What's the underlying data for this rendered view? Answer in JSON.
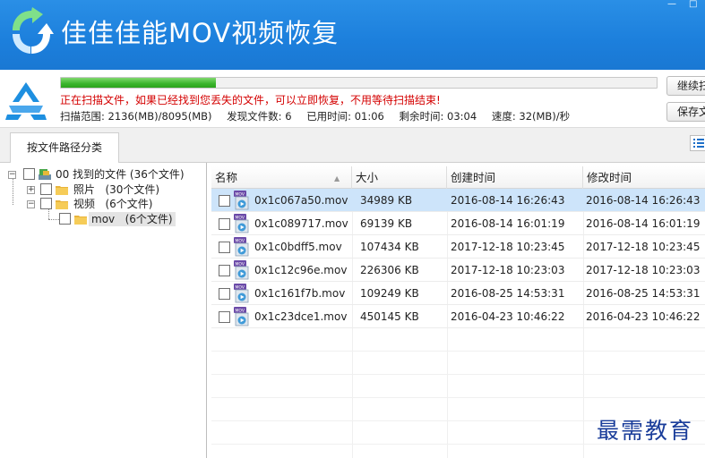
{
  "app": {
    "title": "佳佳佳能MOV视频恢复",
    "logo_icon": "recycle-arrows-logo",
    "colors": {
      "titlebar": "#1c7fdc",
      "status_red": "#d40000",
      "progress_green": "#3bb42c",
      "selection": "#cde4fa"
    }
  },
  "scan": {
    "progress": 0.26,
    "status": "正在扫描文件，如果已经找到您丢失的文件，可以立即恢复，不用等待扫描结束!",
    "range": "扫描范围: 2136(MB)/8095(MB)",
    "found": "发现文件数: 6",
    "elapsed": "已用时间: 01:06",
    "remaining": "剩余时间: 03:04",
    "speed": "速度: 32(MB)/秒",
    "buttons": {
      "continue": "继续扫",
      "save": "保存文"
    }
  },
  "tabs": {
    "by_path": "按文件路径分类"
  },
  "tree": {
    "root": {
      "label": "00 找到的文件",
      "count": "(36个文件)"
    },
    "photos": {
      "label": "照片",
      "count": "(30个文件)"
    },
    "videos": {
      "label": "视频",
      "count": "(6个文件)"
    },
    "mov": {
      "label": "mov",
      "count": "(6个文件)"
    }
  },
  "list": {
    "columns": {
      "name": "名称",
      "size": "大小",
      "created": "创建时间",
      "modified": "修改时间"
    },
    "rows": [
      {
        "name": "0x1c067a50.mov",
        "size": "34989 KB",
        "created": "2016-08-14  16:26:43",
        "modified": "2016-08-14  16:26:43"
      },
      {
        "name": "0x1c089717.mov",
        "size": "69139 KB",
        "created": "2016-08-14  16:01:19",
        "modified": "2016-08-14  16:01:19"
      },
      {
        "name": "0x1c0bdff5.mov",
        "size": "107434 KB",
        "created": "2017-12-18  10:23:45",
        "modified": "2017-12-18  10:23:45"
      },
      {
        "name": "0x1c12c96e.mov",
        "size": "226306 KB",
        "created": "2017-12-18  10:23:03",
        "modified": "2017-12-18  10:23:03"
      },
      {
        "name": "0x1c161f7b.mov",
        "size": "109249 KB",
        "created": "2016-08-25  14:53:31",
        "modified": "2016-08-25  14:53:31"
      },
      {
        "name": "0x1c23dce1.mov",
        "size": "450145 KB",
        "created": "2016-04-23  10:46:22",
        "modified": "2016-04-23  10:46:22"
      }
    ]
  },
  "watermark": "最需教育"
}
